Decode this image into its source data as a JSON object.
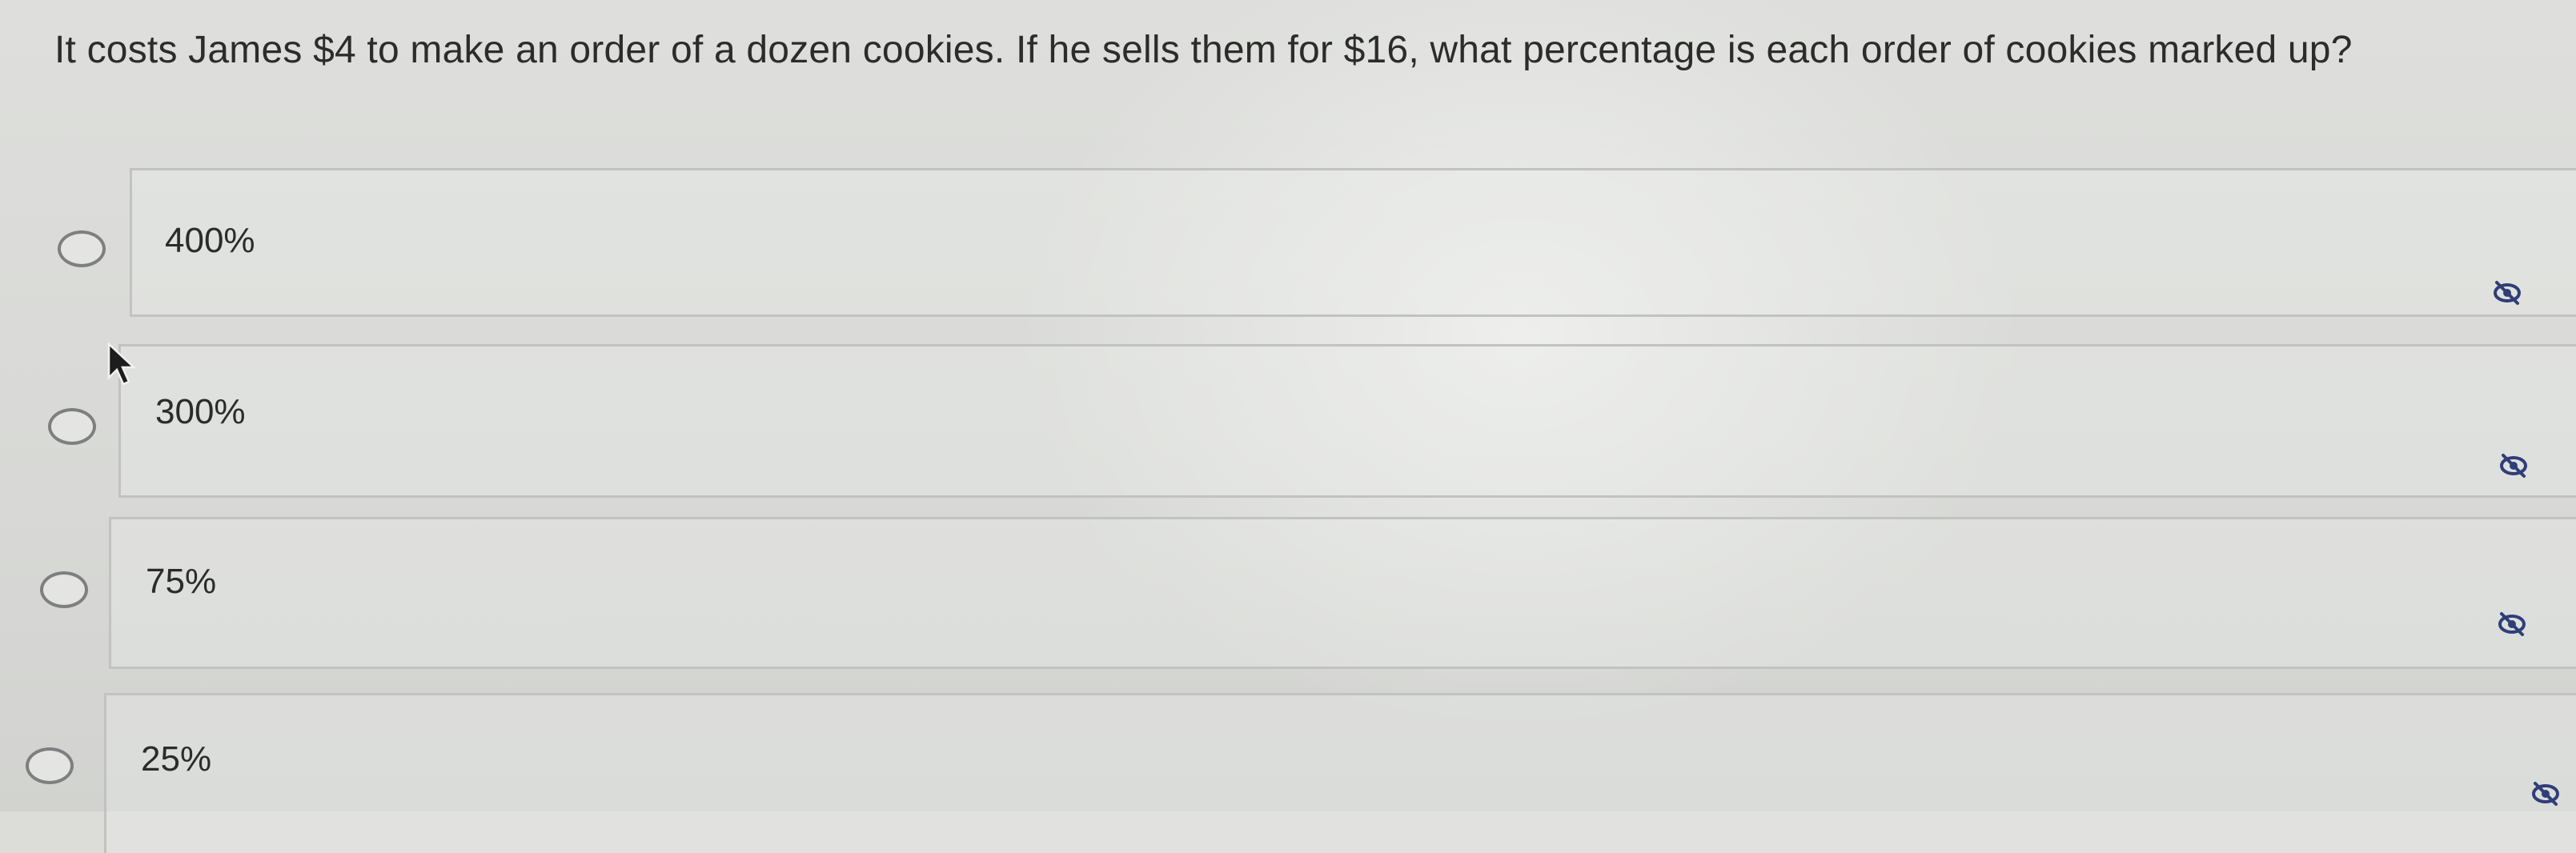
{
  "question": {
    "text": "It costs James $4 to make an order of a dozen cookies. If he sells them for $16, what percentage is each order of cookies marked up?"
  },
  "choices": [
    {
      "label": "400%",
      "selected": false,
      "hide_icon": "eye-off-icon"
    },
    {
      "label": "300%",
      "selected": false,
      "hide_icon": "eye-off-icon"
    },
    {
      "label": "75%",
      "selected": false,
      "hide_icon": "eye-off-icon"
    },
    {
      "label": "25%",
      "selected": false,
      "hide_icon": "eye-off-icon"
    }
  ],
  "colors": {
    "background": "#dcdcd9",
    "text": "#2b2b2b",
    "border": "#c2c3c0",
    "radio": "#7d7f80",
    "icon": "#2f3e78"
  }
}
